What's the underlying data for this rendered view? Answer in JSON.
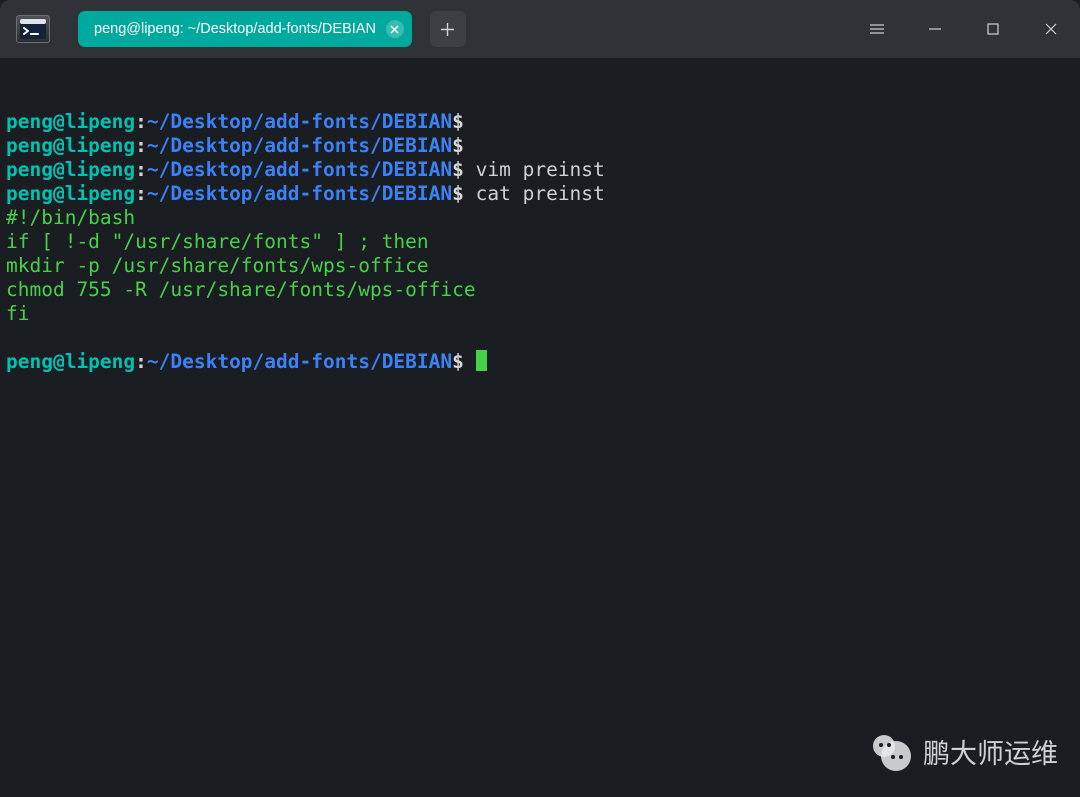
{
  "tab": {
    "title": "peng@lipeng: ~/Desktop/add-fonts/DEBIAN"
  },
  "prompt": {
    "user_host": "peng@lipeng",
    "separator": ":",
    "path": "~/Desktop/add-fonts/DEBIAN",
    "symbol": "$"
  },
  "lines": [
    {
      "type": "prompt",
      "cmd": ""
    },
    {
      "type": "prompt",
      "cmd": ""
    },
    {
      "type": "prompt",
      "cmd": "vim preinst"
    },
    {
      "type": "prompt",
      "cmd": "cat preinst"
    },
    {
      "type": "output",
      "text": "#!/bin/bash"
    },
    {
      "type": "output",
      "text": "if [ !-d \"/usr/share/fonts\" ] ; then"
    },
    {
      "type": "output",
      "text": "mkdir -p /usr/share/fonts/wps-office"
    },
    {
      "type": "output",
      "text": "chmod 755 -R /usr/share/fonts/wps-office"
    },
    {
      "type": "output",
      "text": "fi"
    },
    {
      "type": "blank"
    },
    {
      "type": "prompt_cursor"
    }
  ],
  "watermark": "鹏大师运维"
}
